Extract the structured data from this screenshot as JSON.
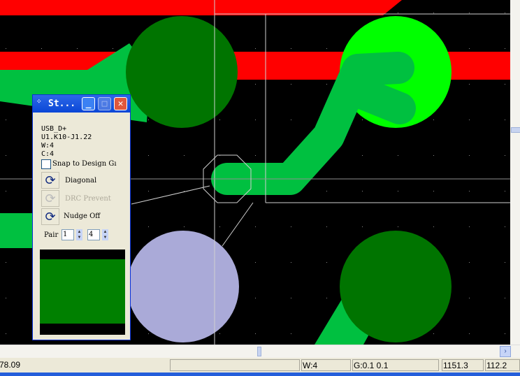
{
  "panel": {
    "title": "St...",
    "net": "USB_D+",
    "connection": "U1.K10-J1.22",
    "width": "W:4",
    "clearance": "C:4",
    "snap_label": "Snap to Design Gı",
    "diagonal_label": "Diagonal",
    "drc_label": "DRC Prevent",
    "nudge_label": "Nudge Off",
    "pair_label": "Pair",
    "pair_value_1": "1",
    "pair_value_2": "4"
  },
  "status": {
    "coord": "78.09",
    "empty": "",
    "width": "W:4",
    "grid": "G:0.1 0.1",
    "x": "1151.3",
    "y": "112.2"
  },
  "colors": {
    "trace_red": "#ff0000",
    "pad_dark": "#007400",
    "pad_bright": "#00ff00",
    "route": "#00c040",
    "pad_lavender": "#aaaad8"
  }
}
